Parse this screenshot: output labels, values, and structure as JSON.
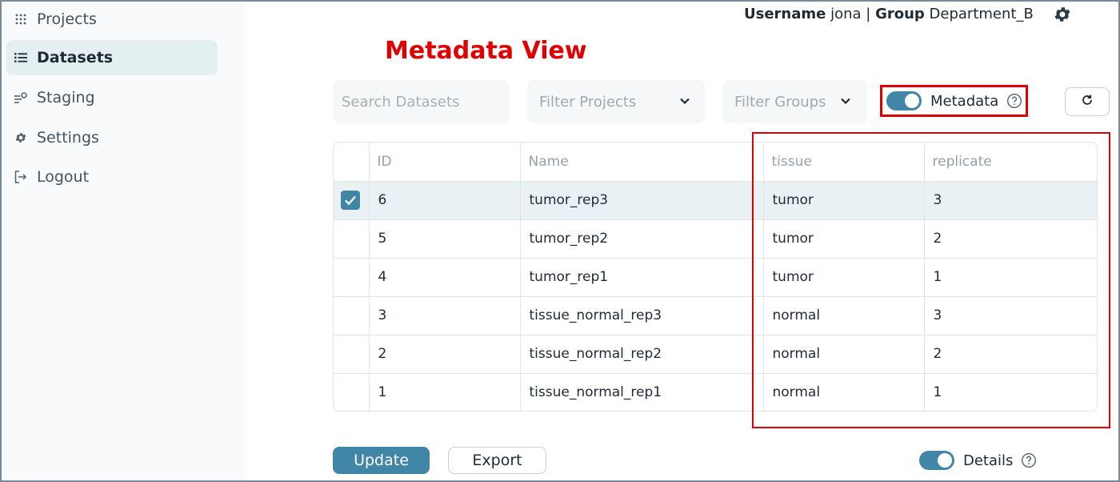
{
  "sidebar": {
    "items": [
      {
        "label": "Projects",
        "icon": "grid-dots-icon",
        "active": false
      },
      {
        "label": "Datasets",
        "icon": "list-icon",
        "active": true
      },
      {
        "label": "Staging",
        "icon": "staging-icon",
        "active": false
      },
      {
        "label": "Settings",
        "icon": "gear-icon",
        "active": false
      },
      {
        "label": "Logout",
        "icon": "logout-icon",
        "active": false
      }
    ]
  },
  "header": {
    "username_label": "Username",
    "username": "jona",
    "separator": "|",
    "group_label": "Group",
    "group": "Department_B",
    "settings_icon": "gear-icon"
  },
  "page_title": "Metadata View",
  "toolbar": {
    "search_placeholder": "Search Datasets",
    "filter_projects": "Filter Projects",
    "filter_groups": "Filter Groups",
    "metadata_toggle_label": "Metadata",
    "metadata_toggle_on": true,
    "refresh_icon": "refresh-icon"
  },
  "table": {
    "columns": [
      "",
      "ID",
      "Name",
      "tissue",
      "replicate"
    ],
    "rows": [
      {
        "id": "6",
        "name": "tumor_rep3",
        "tissue": "tumor",
        "replicate": "3",
        "selected": true
      },
      {
        "id": "5",
        "name": "tumor_rep2",
        "tissue": "tumor",
        "replicate": "2",
        "selected": false
      },
      {
        "id": "4",
        "name": "tumor_rep1",
        "tissue": "tumor",
        "replicate": "1",
        "selected": false
      },
      {
        "id": "3",
        "name": "tissue_normal_rep3",
        "tissue": "normal",
        "replicate": "3",
        "selected": false
      },
      {
        "id": "2",
        "name": "tissue_normal_rep2",
        "tissue": "normal",
        "replicate": "2",
        "selected": false
      },
      {
        "id": "1",
        "name": "tissue_normal_rep1",
        "tissue": "normal",
        "replicate": "1",
        "selected": false
      }
    ]
  },
  "footer": {
    "update_label": "Update",
    "export_label": "Export",
    "details_label": "Details",
    "details_toggle_on": true
  },
  "colors": {
    "accent": "#4186a6",
    "highlight_red": "#e00000",
    "active_nav_bg": "#e3eff0"
  }
}
